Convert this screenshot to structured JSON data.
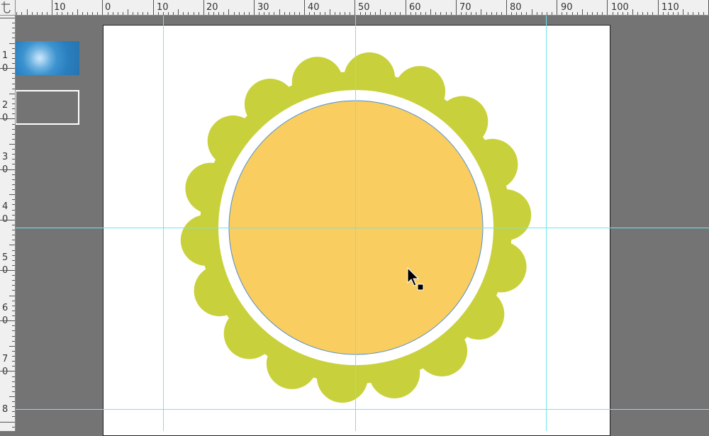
{
  "rulers": {
    "horizontal_labels": [
      "10",
      "0",
      "10",
      "20",
      "30",
      "40",
      "50",
      "60",
      "70",
      "80",
      "90",
      "100",
      "110"
    ],
    "vertical_labels": [
      [
        "1",
        "0"
      ],
      [
        "2",
        "0"
      ],
      [
        "3",
        "0"
      ],
      [
        "4",
        "0"
      ],
      [
        "5",
        "0"
      ],
      [
        "6",
        "0"
      ],
      [
        "7",
        "0"
      ],
      [
        "8"
      ]
    ]
  },
  "artwork": {
    "scallop_color": "#c8d13b",
    "ring_color": "#ffffff",
    "fill_color": "#f9cd5f",
    "outline_color": "#4d8fd1",
    "petal_count": 18
  },
  "guides": {
    "color": "#6fe6ee"
  },
  "canvas": {
    "background": "#747474",
    "artboard": "#ffffff"
  },
  "tool": {
    "cursor": "direct-selection-arrow-icon"
  }
}
